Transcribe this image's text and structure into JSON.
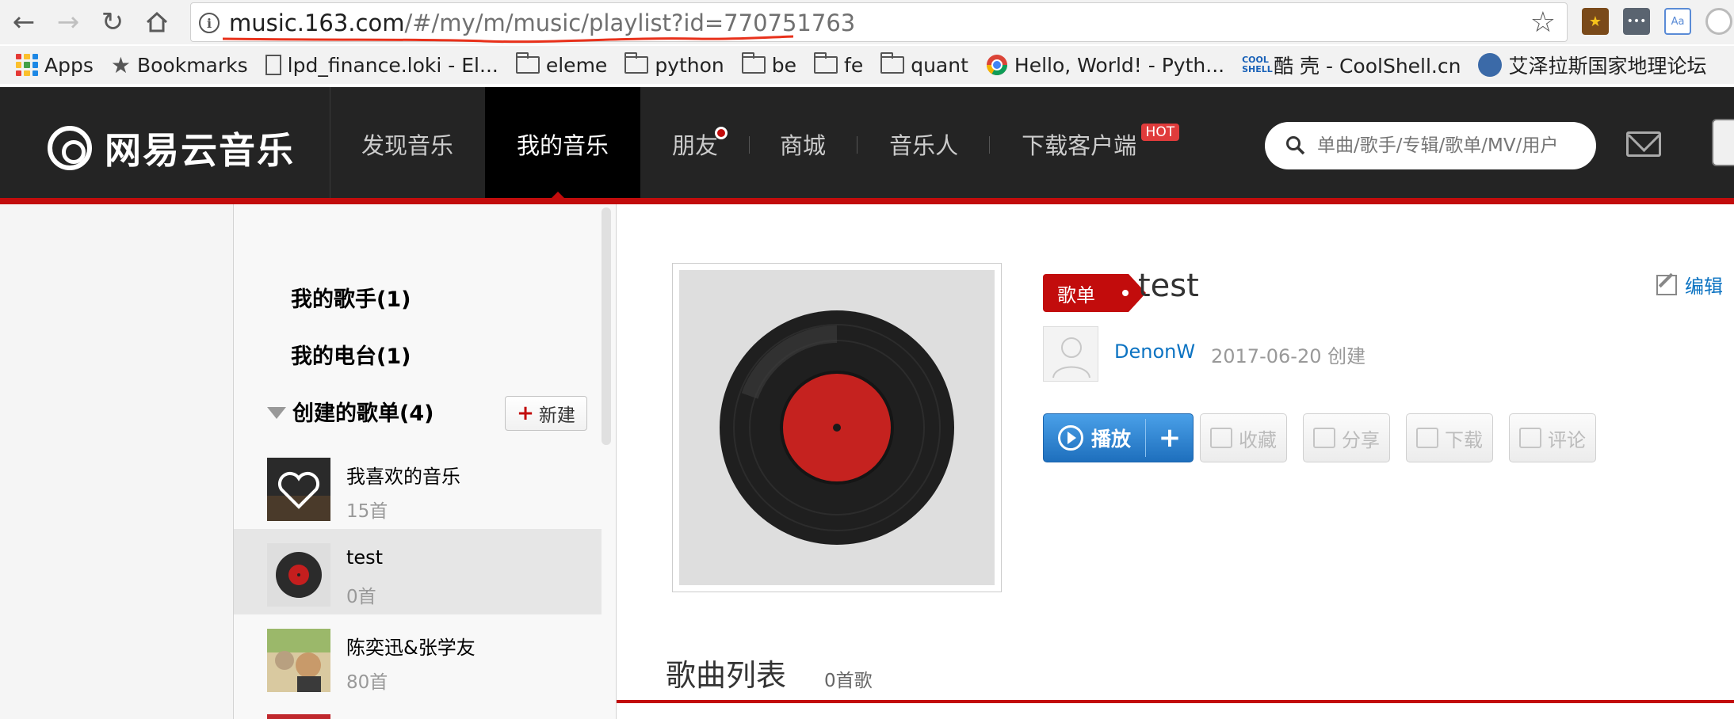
{
  "browser": {
    "url_domain": "music.163.com",
    "url_rest": "/#/my/m/music/playlist?id=770751763",
    "bookmarks": [
      {
        "label": "Apps",
        "icon": "apps-grid-icon"
      },
      {
        "label": "Bookmarks",
        "icon": "star-icon"
      },
      {
        "label": "lpd_finance.loki - El...",
        "icon": "page-icon"
      },
      {
        "label": "eleme",
        "icon": "folder-icon"
      },
      {
        "label": "python",
        "icon": "folder-icon"
      },
      {
        "label": "be",
        "icon": "folder-icon"
      },
      {
        "label": "fe",
        "icon": "folder-icon"
      },
      {
        "label": "quant",
        "icon": "folder-icon"
      },
      {
        "label": "Hello, World! - Pyth...",
        "icon": "chrome-icon"
      },
      {
        "label": "酷 壳 - CoolShell.cn",
        "icon": "coolshell-icon"
      },
      {
        "label": "艾泽拉斯国家地理论坛",
        "icon": "ngabbs-icon"
      }
    ],
    "coolshell_logo_text": "COOL SHELL",
    "ext_aa_text": "Aa"
  },
  "header": {
    "logo_text": "网易云音乐",
    "nav": [
      {
        "label": "发现音乐"
      },
      {
        "label": "我的音乐"
      },
      {
        "label": "朋友"
      },
      {
        "label": "商城"
      },
      {
        "label": "音乐人"
      },
      {
        "label": "下载客户端"
      }
    ],
    "hot_badge": "HOT",
    "search_placeholder": "单曲/歌手/专辑/歌单/MV/用户"
  },
  "sidebar": {
    "my_singers": "我的歌手(1)",
    "my_radio": "我的电台(1)",
    "created_playlists": "创建的歌单(4)",
    "new_button": "新建",
    "new_plus": "+",
    "playlists": [
      {
        "name": "我喜欢的音乐",
        "count": "15首"
      },
      {
        "name": "test",
        "count": "0首"
      },
      {
        "name": "陈奕迅&张学友",
        "count": "80首"
      }
    ]
  },
  "playlist": {
    "tag": "歌单",
    "title": "test",
    "edit_label": "编辑",
    "creator": "DenonW",
    "created_text": "2017-06-20 创建",
    "play_label": "播放",
    "add_label": "+",
    "actions": [
      "收藏",
      "分享",
      "下载",
      "评论"
    ],
    "songs_heading": "歌曲列表",
    "songs_count": "0首歌"
  },
  "colors": {
    "brand_red": "#c20c0c",
    "link_blue": "#0c73c2",
    "header_bg": "#242424"
  }
}
